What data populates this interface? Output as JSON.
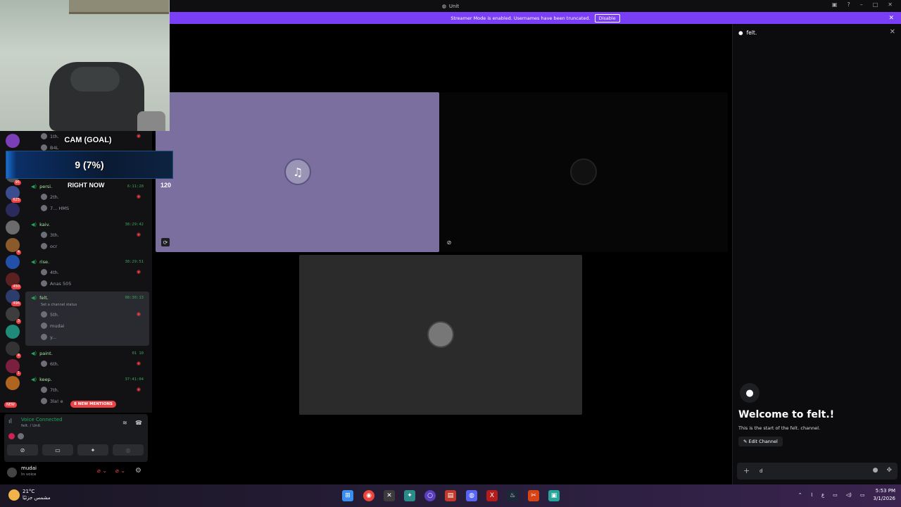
{
  "window": {
    "title": "Unit"
  },
  "banner": {
    "text": "Streamer Mode is enabled. Usernames have been truncated.",
    "disable_label": "Disable"
  },
  "overlay": {
    "cam_goal": "CAM (GOAL)",
    "progress_text": "9 (7%)",
    "progress_fraction": 0.07,
    "right_now": "RIGHT NOW",
    "count": "120"
  },
  "servers": [
    {
      "badge": ""
    },
    {
      "badge": ""
    },
    {
      "badge": "95"
    },
    {
      "badge": "625"
    },
    {
      "badge": ""
    },
    {
      "badge": ""
    },
    {
      "badge": "4"
    },
    {
      "badge": ""
    },
    {
      "badge": "450"
    },
    {
      "badge": "496"
    },
    {
      "badge": "3"
    },
    {
      "badge": ""
    },
    {
      "badge": "4"
    },
    {
      "badge": "1"
    },
    {
      "badge": ""
    }
  ],
  "new_label": "NEW",
  "channels": [
    {
      "name": "",
      "time": "",
      "users": [
        "1th.",
        "B4L"
      ]
    },
    {
      "name": "persi.",
      "time": "6:11:20",
      "users": [
        "2th.",
        "7... HMS"
      ]
    },
    {
      "name": "kaiv.",
      "time": "38:29:42",
      "users": [
        "3th.",
        "ocr"
      ]
    },
    {
      "name": "rise.",
      "time": "38:29:51",
      "users": [
        "4th.",
        "Anas 505"
      ]
    },
    {
      "name": "felt.",
      "time": "08:30:13",
      "status": "Set a channel status",
      "users": [
        "5th.",
        "mudai",
        "y..."
      ]
    },
    {
      "name": "paint.",
      "time": "01 10",
      "users": [
        "6th."
      ]
    },
    {
      "name": "keep.",
      "time": "37:41:04",
      "users": [
        "7th.",
        "3la! e"
      ]
    }
  ],
  "mentions_label": "8 NEW MENTIONS",
  "voice": {
    "title": "Voice Connected",
    "subtitle": "felt. / Unit"
  },
  "user": {
    "name": "mudai",
    "status": "In voice"
  },
  "chat": {
    "channel": "felt.",
    "welcome_title": "Welcome to felt.!",
    "welcome_sub": "This is the start of the felt. channel.",
    "edit_label": "Edit Channel",
    "input_value": "d"
  },
  "taskbar": {
    "temp": "21°C",
    "weather_text": "مشمس جزئيًا",
    "time": "5:53 PM",
    "date": "3/1/2026",
    "lang": "ع"
  },
  "colors": {
    "banner": "#7a3ef6",
    "tile_a": "#7b6fa0",
    "tile_c": "#2b2b2b",
    "voice_green": "#23a55a"
  }
}
